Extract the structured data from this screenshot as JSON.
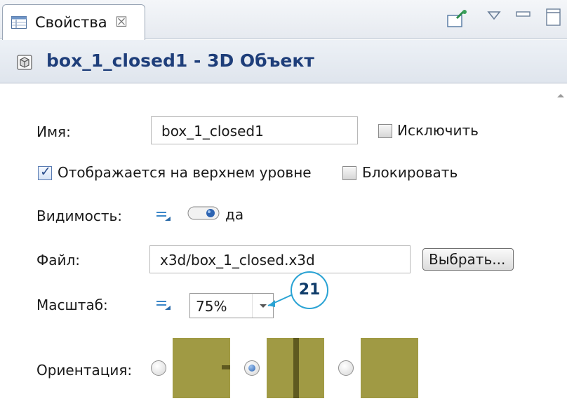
{
  "tab": {
    "label": "Свойства",
    "close_glyph": "☒"
  },
  "title": {
    "text": "box_1_closed1 - 3D Объект",
    "icon": "3d-object-icon"
  },
  "form": {
    "name_label": "Имя:",
    "name_value": "box_1_closed1",
    "exclude_label": "Исключить",
    "exclude_checked": false,
    "top_level_label": "Отображается на верхнем уровне",
    "top_level_checked": true,
    "lock_label": "Блокировать",
    "lock_checked": false,
    "visibility_label": "Видимость:",
    "visibility_value": "да",
    "visibility_on": true,
    "file_label": "Файл:",
    "file_value": "x3d/box_1_closed.x3d",
    "browse_label": "Выбрать...",
    "scale_label": "Масштаб:",
    "scale_value": "75%",
    "orientation_label": "Ориентация:",
    "orientation_selected": 2
  },
  "callout": {
    "number": "21"
  },
  "colors": {
    "accent": "#1e3e7a",
    "swatch": "#a09a44",
    "callout_border": "#2aa3d4"
  }
}
